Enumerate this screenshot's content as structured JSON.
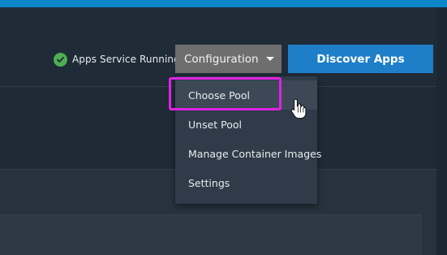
{
  "header": {
    "status": {
      "label": "Apps Service Running",
      "icon": "check-circle-icon",
      "color": "#4caf50"
    },
    "configuration_button": {
      "label": "Configuration",
      "icon": "caret-down-icon"
    },
    "discover_button": {
      "label": "Discover Apps",
      "color": "#1e7fc8"
    }
  },
  "configuration_menu": {
    "items": [
      {
        "label": "Choose Pool",
        "state": "hovered"
      },
      {
        "label": "Unset Pool"
      },
      {
        "label": "Manage Container Images"
      },
      {
        "label": "Settings"
      }
    ]
  },
  "annotation": {
    "type": "highlight-box",
    "color": "#e121e6"
  },
  "cursor": {
    "type": "pointer-hand-icon"
  }
}
